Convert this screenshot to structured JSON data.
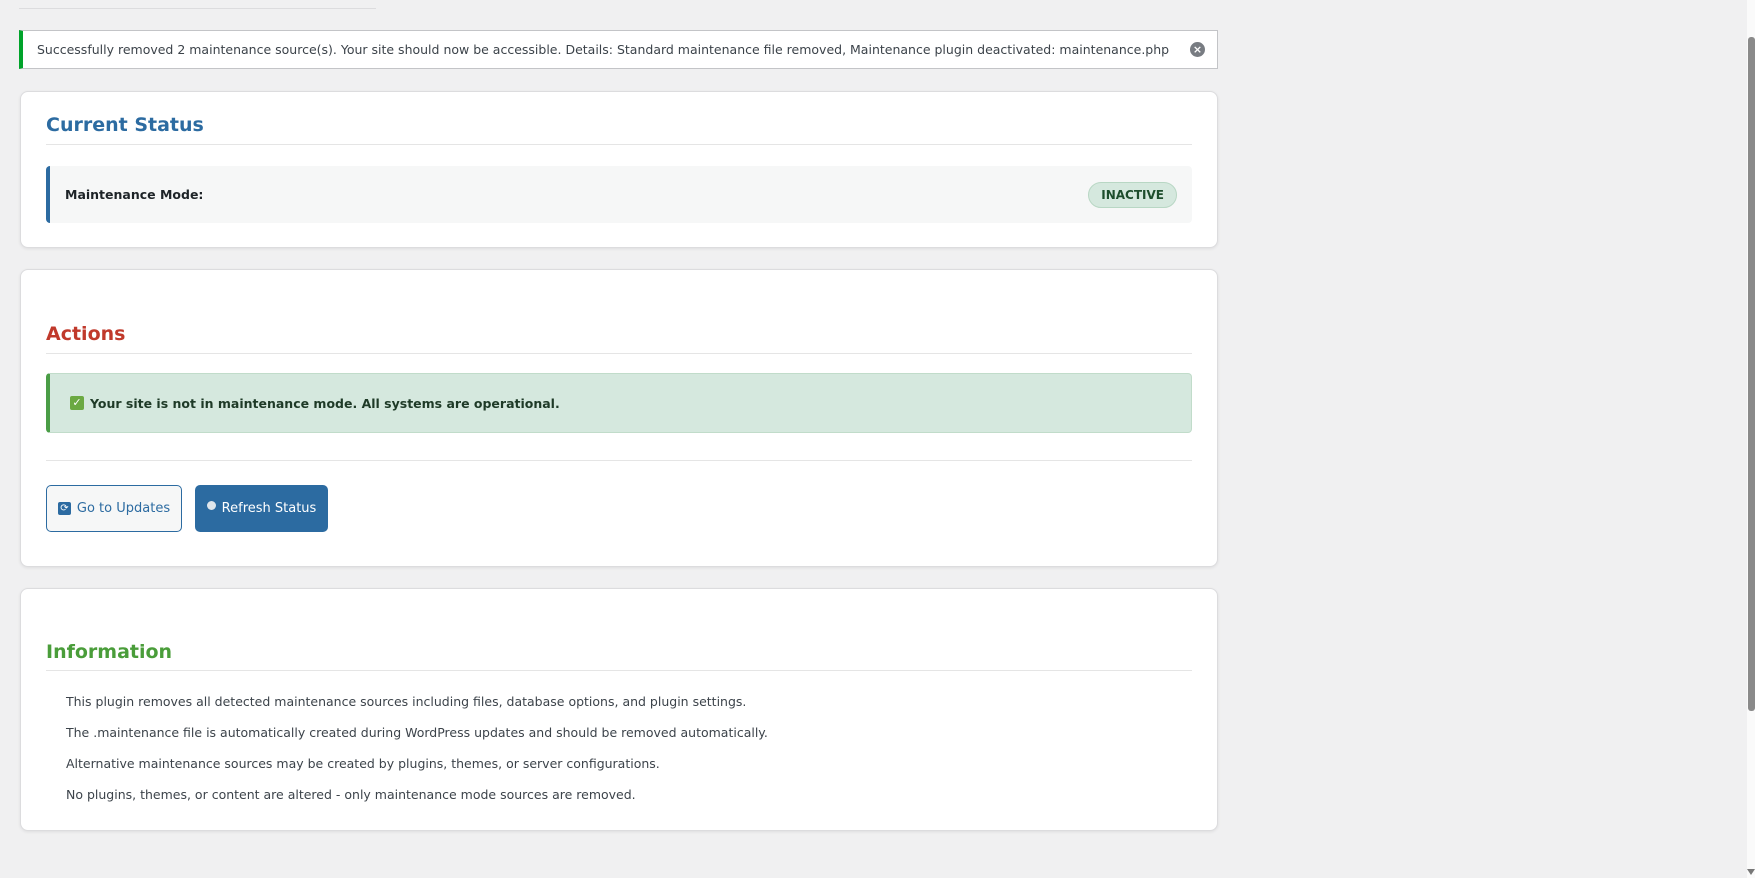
{
  "notice": {
    "text": "Successfully removed 2 maintenance source(s). Your site should now be accessible. Details: Standard maintenance file removed, Maintenance plugin deactivated: maintenance.php",
    "dismiss_icon": "close-circle-icon"
  },
  "status": {
    "title": "Current Status",
    "label": "Maintenance Mode:",
    "badge": "INACTIVE"
  },
  "actions": {
    "title": "Actions",
    "message": "Your site is not in maintenance mode. All systems are operational.",
    "check_icon": "✓",
    "go_updates": "Go to Updates",
    "refresh": "Refresh Status"
  },
  "information": {
    "title": "Information",
    "lines": [
      "This plugin removes all detected maintenance sources including files, database options, and plugin settings.",
      "The .maintenance file is automatically created during WordPress updates and should be removed automatically.",
      "Alternative maintenance sources may be created by plugins, themes, or server configurations.",
      "No plugins, themes, or content are altered - only maintenance mode sources are removed."
    ]
  },
  "colors": {
    "status_title": "#2c6ba1",
    "actions_title": "#c0392b",
    "info_title": "#4a9d3a",
    "success": "#00a32a"
  }
}
